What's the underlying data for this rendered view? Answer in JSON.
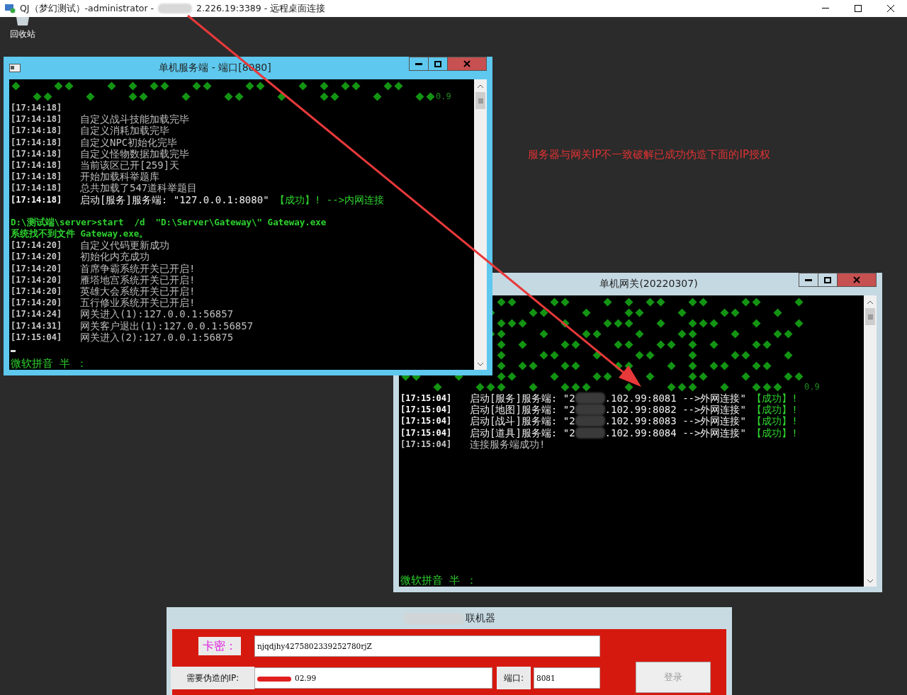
{
  "remote_title": {
    "prefix": "QJ（梦幻测试）-administrator -",
    "suffix": "2.226.19:3389 - 远程桌面连接"
  },
  "desktop_icons": [
    {
      "label": "回收站"
    }
  ],
  "annotation": "服务器与网关IP不一致破解已成功伪造下面的IP授权",
  "server_window": {
    "title": "单机服务端 - 端口[8080]",
    "version_mark": "0.9",
    "ime_status": "微软拼音 半 ：",
    "lines": [
      {
        "kind": "log",
        "time": "[17:14:18]"
      },
      {
        "kind": "log",
        "time": "[17:14:18]",
        "text": "自定义战斗技能加载完毕"
      },
      {
        "kind": "log",
        "time": "[17:14:18]",
        "text": "自定义消耗加载完毕"
      },
      {
        "kind": "log",
        "time": "[17:14:18]",
        "text": "自定义NPC初始化完毕"
      },
      {
        "kind": "log",
        "time": "[17:14:18]",
        "text": "自定义怪物数据加载完毕"
      },
      {
        "kind": "log",
        "time": "[17:14:18]",
        "text": "当前该区已开[259]天"
      },
      {
        "kind": "log",
        "time": "[17:14:18]",
        "text": "开始加载科举题库"
      },
      {
        "kind": "log",
        "time": "[17:14:18]",
        "text": "总共加载了547道科举题目"
      },
      {
        "kind": "launch",
        "time": "[17:14:18]",
        "text": "启动[服务]服务端: \"127.0.0.1:8080\"",
        "status": "【成功】! -->内网连接"
      },
      {
        "kind": "blank"
      },
      {
        "kind": "command",
        "text": "D:\\测试端\\server>start  /d  \"D:\\Server\\Gateway\\\" Gateway.exe"
      },
      {
        "kind": "command",
        "text": "系统找不到文件 Gateway.exe。"
      },
      {
        "kind": "log",
        "time": "[17:14:20]",
        "text": "自定义代码更新成功"
      },
      {
        "kind": "log",
        "time": "[17:14:20]",
        "text": "初始化内充成功"
      },
      {
        "kind": "log",
        "time": "[17:14:20]",
        "text": "首席争霸系统开关已开启!"
      },
      {
        "kind": "log",
        "time": "[17:14:20]",
        "text": "雁塔地宫系统开关已开启!"
      },
      {
        "kind": "log",
        "time": "[17:14:20]",
        "text": "英雄大会系统开关已开启!"
      },
      {
        "kind": "log",
        "time": "[17:14:20]",
        "text": "五行修业系统开关已开启!"
      },
      {
        "kind": "log",
        "time": "[17:14:24]",
        "text": "网关进入(1):127.0.0.1:56857"
      },
      {
        "kind": "log",
        "time": "[17:14:31]",
        "text": "网关客户退出(1):127.0.0.1:56857"
      },
      {
        "kind": "log",
        "time": "[17:15:04]",
        "text": "网关进入(2):127.0.0.1:56875"
      },
      {
        "kind": "cursor"
      }
    ]
  },
  "gateway_window": {
    "title": "单机网关(20220307)",
    "version_mark": "0.9",
    "ime_status": "微软拼音 半 ：",
    "lines": [
      {
        "kind": "launch",
        "time": "[17:15:04]",
        "text": "启动[服务]服务端: \"2",
        "text_after": ".102.99:8081 -->外网连接\"",
        "status": "【成功】!"
      },
      {
        "kind": "launch",
        "time": "[17:15:04]",
        "text": "启动[地图]服务端: \"2",
        "text_after": ".102.99:8082 -->外网连接\"",
        "status": "【成功】!"
      },
      {
        "kind": "launch",
        "time": "[17:15:04]",
        "text": "启动[战斗]服务端: \"2",
        "text_after": ".102.99:8083 -->外网连接\"",
        "status": "【成功】!"
      },
      {
        "kind": "launch",
        "time": "[17:15:04]",
        "text": "启动[道具]服务端: \"2",
        "text_after": ".102.99:8084 -->外网连接\"",
        "status": "【成功】!"
      },
      {
        "kind": "log",
        "time": "[17:15:04]",
        "text": "连接服务端成功!"
      }
    ]
  },
  "login_window": {
    "title": "联机器",
    "card_label": "卡密：",
    "card_value": "njqdjhy4275802339252780rjZ",
    "ip_label": "需要伪造的IP:",
    "ip_value": "02.99",
    "port_label": "端口:",
    "port_value": "8081",
    "login_button": "登录"
  }
}
